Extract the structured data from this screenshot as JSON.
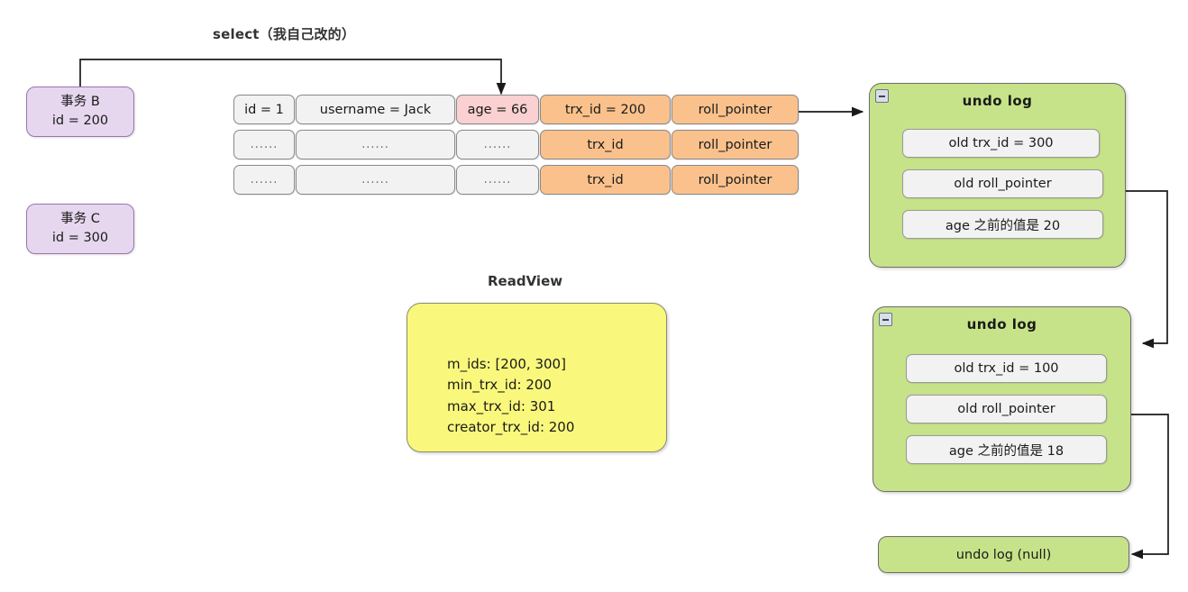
{
  "diagram": {
    "title": "select（我自己改的）",
    "readview_label": "ReadView"
  },
  "colors": {
    "transaction_fill": "#E6D7EE",
    "transaction_stroke": "#9A75B0",
    "record_plain": "#F2F2F2",
    "record_highlight": "#FAD0D0",
    "record_pointer": "#FAC18C",
    "undo_fill": "#C6E389",
    "readview_fill": "#FAF87C",
    "wire": "#1a1a1a"
  },
  "transactions": [
    {
      "name": "事务 B",
      "id_text": "id = 200"
    },
    {
      "name": "事务 C",
      "id_text": "id = 300"
    }
  ],
  "record_table": {
    "columns": [
      "id",
      "username",
      "age",
      "trx_id",
      "roll_pointer"
    ],
    "rows": [
      {
        "id": "id = 1",
        "username": "username = Jack",
        "age": "age = 66",
        "trx_id": "trx_id = 200",
        "roll_pointer": "roll_pointer"
      },
      {
        "id": "......",
        "username": "......",
        "age": "......",
        "trx_id": "trx_id",
        "roll_pointer": "roll_pointer"
      },
      {
        "id": "......",
        "username": "......",
        "age": "......",
        "trx_id": "trx_id",
        "roll_pointer": "roll_pointer"
      }
    ]
  },
  "readview": {
    "m_ids": "m_ids: [200, 300]",
    "min_trx_id": "min_trx_id: 200",
    "max_trx_id": "max_trx_id: 301",
    "creator_trx_id": "creator_trx_id: 200"
  },
  "undo_logs": [
    {
      "title": "undo log",
      "rows": [
        "old trx_id = 300",
        "old roll_pointer",
        "age 之前的值是 20"
      ]
    },
    {
      "title": "undo log",
      "rows": [
        "old trx_id = 100",
        "old roll_pointer",
        "age 之前的值是 18"
      ]
    }
  ],
  "undo_null": {
    "label": "undo log (null)"
  }
}
